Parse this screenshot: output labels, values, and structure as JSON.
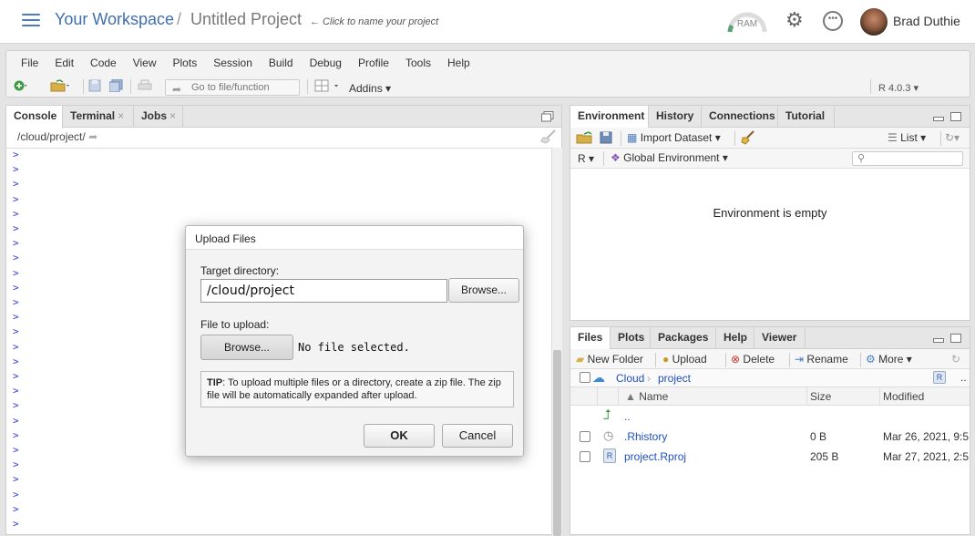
{
  "header": {
    "workspace": "Your Workspace",
    "separator": "/",
    "project": "Untitled Project",
    "project_hint": "← Click to name your project",
    "ram_label": "RAM",
    "user_name": "Brad Duthie",
    "accent": "#3f6fb0"
  },
  "menu": {
    "items": [
      "File",
      "Edit",
      "Code",
      "View",
      "Plots",
      "Session",
      "Build",
      "Debug",
      "Profile",
      "Tools",
      "Help"
    ]
  },
  "toolbar": {
    "goto_placeholder": "Go to file/function",
    "addins": "Addins",
    "r_version": "R 4.0.3"
  },
  "console": {
    "tabs": [
      {
        "label": "Console"
      },
      {
        "label": "Terminal"
      },
      {
        "label": "Jobs"
      }
    ],
    "path": "/cloud/project/",
    "prompt": ">"
  },
  "environment": {
    "tabs": [
      "Environment",
      "History",
      "Connections",
      "Tutorial"
    ],
    "import_dataset": "Import Dataset",
    "list_label": "List",
    "language": "R",
    "scope": "Global Environment",
    "empty_message": "Environment is empty"
  },
  "files": {
    "tabs": [
      "Files",
      "Plots",
      "Packages",
      "Help",
      "Viewer"
    ],
    "actions": {
      "new_folder": "New Folder",
      "upload": "Upload",
      "delete": "Delete",
      "rename": "Rename",
      "more": "More"
    },
    "breadcrumb": [
      "Cloud",
      "project"
    ],
    "columns": {
      "name": "Name",
      "size": "Size",
      "modified": "Modified"
    },
    "parent": "..",
    "rows": [
      {
        "name": ".Rhistory",
        "size": "0 B",
        "modified": "Mar 26, 2021, 9:5"
      },
      {
        "name": "project.Rproj",
        "size": "205 B",
        "modified": "Mar 27, 2021, 2:5"
      }
    ]
  },
  "dialog": {
    "title": "Upload Files",
    "target_label": "Target directory:",
    "target_value": "/cloud/project",
    "browse_dir": "Browse...",
    "file_label": "File to upload:",
    "browse_file": "Browse...",
    "no_file": "No file selected.",
    "tip_bold": "TIP",
    "tip_text": ": To upload multiple files or a directory, create a zip file. The zip file will be automatically expanded after upload.",
    "ok": "OK",
    "cancel": "Cancel"
  }
}
